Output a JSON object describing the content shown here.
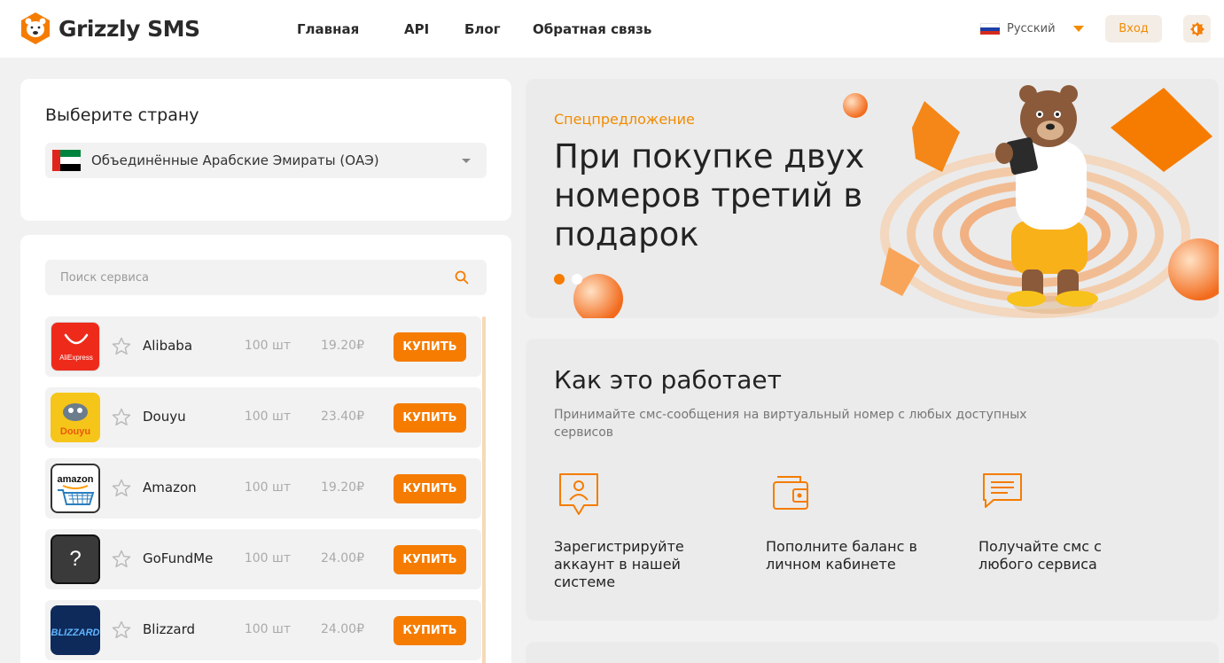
{
  "header": {
    "logo_text": "Grizzly SMS",
    "nav": [
      "Главная",
      "API",
      "Блог",
      "Обратная связь"
    ],
    "language": "Русский",
    "login_label": "Вход"
  },
  "country": {
    "title": "Выберите страну",
    "selected": "Объединённые Арабские Эмираты (ОАЭ)"
  },
  "search": {
    "placeholder": "Поиск сервиса"
  },
  "services": [
    {
      "name": "Alibaba",
      "count": "100 шт",
      "price": "19.20₽",
      "buy": "КУПИТЬ",
      "logo_text": "AliExpress"
    },
    {
      "name": "Douyu",
      "count": "100 шт",
      "price": "23.40₽",
      "buy": "КУПИТЬ",
      "logo_text": "Douyu"
    },
    {
      "name": "Amazon",
      "count": "100 шт",
      "price": "19.20₽",
      "buy": "КУПИТЬ",
      "logo_text": "amazon"
    },
    {
      "name": "GoFundMe",
      "count": "100 шт",
      "price": "24.00₽",
      "buy": "КУПИТЬ",
      "logo_text": "?"
    },
    {
      "name": "Blizzard",
      "count": "100 шт",
      "price": "24.00₽",
      "buy": "КУПИТЬ",
      "logo_text": "BLIZZARD"
    }
  ],
  "promo": {
    "kicker": "Спецпредложение",
    "title": "При покупке двух номеров третий в подарок"
  },
  "how": {
    "title": "Как это работает",
    "subtitle": "Принимайте смс-сообщения на виртуальный номер с любых доступных сервисов",
    "steps": [
      "Зарегистрируйте аккаунт в нашей системе",
      "Пополните баланс в личном кабинете",
      "Получайте смс с любого сервиса"
    ]
  },
  "colors": {
    "accent": "#f57c00",
    "background": "#f1f1f1"
  }
}
